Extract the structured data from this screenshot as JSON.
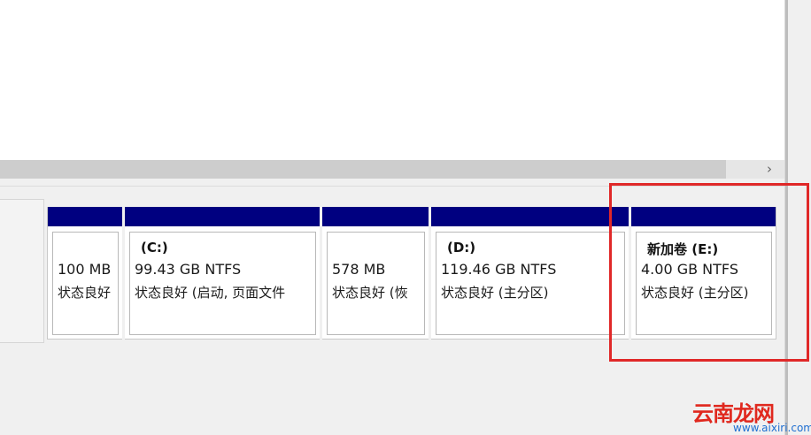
{
  "scroll": {
    "right_arrow": "›"
  },
  "partitions": [
    {
      "name": "",
      "size": "100 MB",
      "status": "状态良好"
    },
    {
      "name": "(C:)",
      "size": "99.43 GB NTFS",
      "status": "状态良好 (启动, 页面文件"
    },
    {
      "name": "",
      "size": "578 MB",
      "status": "状态良好 (恢"
    },
    {
      "name": "(D:)",
      "size": "119.46 GB NTFS",
      "status": "状态良好 (主分区)"
    },
    {
      "name": "新加卷  (E:)",
      "size": "4.00 GB NTFS",
      "status": "状态良好 (主分区)"
    }
  ],
  "colors": {
    "partition_bar": "#000080",
    "highlight": "#e02828"
  },
  "watermark": {
    "main": "云南龙网",
    "sub": "www.aixiri.com"
  }
}
